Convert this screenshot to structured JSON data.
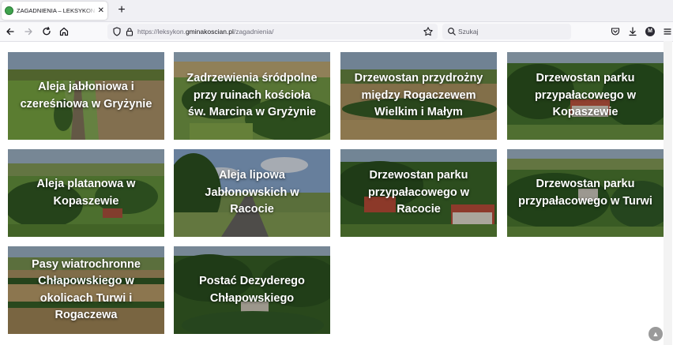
{
  "browser": {
    "tab_title": "ZAGADNIENIA – LEKSYKON – Gmina Kościan",
    "new_tab_symbol": "+",
    "close_symbol": "✕",
    "url_prefix": "https://leksykon.",
    "url_domain": "gminakoscian.pl",
    "url_path": "/zagadnienia/",
    "search_placeholder": "Szukaj",
    "account_initial": "M"
  },
  "cards": [
    {
      "title": "Aleja jabłoniowa i czereśniowa w Gryżynie",
      "scene": "avenue"
    },
    {
      "title": "Zadrzewienia śródpolne przy ruinach kościoła św. Marcina w Gryżynie",
      "scene": "fields"
    },
    {
      "title": "Drzewostan przydrożny między Rogaczewem Wielkim i Małym",
      "scene": "road-fields"
    },
    {
      "title": "Drzewostan parku przypałacowego w Kopaszewie",
      "scene": "park"
    },
    {
      "title": "Aleja platanowa w Kopaszewie",
      "scene": "village"
    },
    {
      "title": "Aleja lipowa Jabłonowskich w Racocie",
      "scene": "road-sky"
    },
    {
      "title": "Drzewostan parku przypałacowego w Racocie",
      "scene": "palace"
    },
    {
      "title": "Drzewostan parku przypałacowego w Turwi",
      "scene": "park2"
    },
    {
      "title": "Pasy wiatrochronne Chłapowskiego w okolicach Turwi i Rogaczewa",
      "scene": "fields2"
    },
    {
      "title": "Postać Dezyderego Chłapowskiego",
      "scene": "forest"
    }
  ],
  "icons": {
    "back": "back-arrow-icon",
    "forward": "forward-arrow-icon",
    "reload": "reload-icon",
    "home": "home-icon",
    "pocket": "pocket-icon",
    "download": "download-icon",
    "menu": "hamburger-menu-icon",
    "scroll_top": "chevron-up-icon"
  },
  "colors": {
    "tab_strip": "#f0f0f4",
    "toolbar": "#f9f9fb",
    "favicon": "#3fa34d",
    "card_text": "#ffffff"
  }
}
